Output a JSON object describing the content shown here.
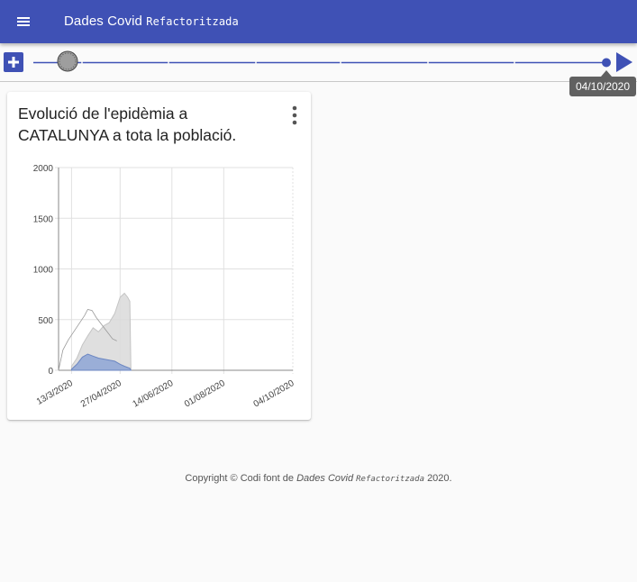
{
  "app": {
    "title": "Dades Covid",
    "title_suffix": "Refactoritzada"
  },
  "icons": {
    "menu": "menu-icon",
    "add": "add-box-icon",
    "play": "play-arrow-icon",
    "more": "more-vert-icon"
  },
  "colors": {
    "primary": "#3f51b5",
    "series_gray": "#d9d9d9",
    "series_blue": "#8ea6d6"
  },
  "timeline": {
    "current_date": "04/10/2020",
    "position": 1.0
  },
  "card": {
    "title": "Evolució de l'epidèmia a CATALUNYA a tota la població."
  },
  "chart_data": {
    "type": "area",
    "title": "",
    "xlabel": "",
    "ylabel": "",
    "x_ticks": [
      "13/3/2020",
      "27/04/2020",
      "14/06/2020",
      "01/08/2020",
      "04/10/2020"
    ],
    "y_ticks": [
      0,
      500,
      1000,
      1500,
      2000
    ],
    "ylim": [
      0,
      2000
    ],
    "xlim": [
      "2020-03-01",
      "2020-10-04"
    ],
    "grid": true,
    "series": [
      {
        "kind": "area",
        "color": "#d9d9d9",
        "x": [
          "2020-03-13",
          "2020-03-18",
          "2020-03-23",
          "2020-03-28",
          "2020-04-02",
          "2020-04-07",
          "2020-04-12",
          "2020-04-17",
          "2020-04-22",
          "2020-04-27",
          "2020-05-01",
          "2020-05-04",
          "2020-05-06",
          "2020-05-07"
        ],
        "y": [
          40,
          120,
          250,
          340,
          420,
          380,
          440,
          470,
          560,
          720,
          760,
          720,
          680,
          0
        ]
      },
      {
        "kind": "area",
        "color": "#8ea6d6",
        "x": [
          "2020-03-13",
          "2020-03-18",
          "2020-03-23",
          "2020-03-28",
          "2020-04-02",
          "2020-04-07",
          "2020-04-12",
          "2020-04-17",
          "2020-04-22",
          "2020-04-27",
          "2020-05-01",
          "2020-05-06",
          "2020-05-07"
        ],
        "y": [
          10,
          60,
          130,
          160,
          140,
          120,
          110,
          100,
          90,
          60,
          40,
          20,
          0
        ]
      },
      {
        "kind": "line",
        "color": "#999999",
        "x": [
          "2020-03-01",
          "2020-03-05",
          "2020-03-10",
          "2020-03-15",
          "2020-03-20",
          "2020-03-25",
          "2020-03-28",
          "2020-04-01",
          "2020-04-05",
          "2020-04-10",
          "2020-04-15",
          "2020-04-20",
          "2020-04-24"
        ],
        "y": [
          0,
          200,
          300,
          380,
          460,
          540,
          600,
          590,
          520,
          450,
          380,
          310,
          290
        ]
      }
    ]
  },
  "footer": {
    "prefix": "Copyright © Codi font de",
    "name": "Dades Covid",
    "name_suffix": "Refactoritzada",
    "year": "2020."
  }
}
